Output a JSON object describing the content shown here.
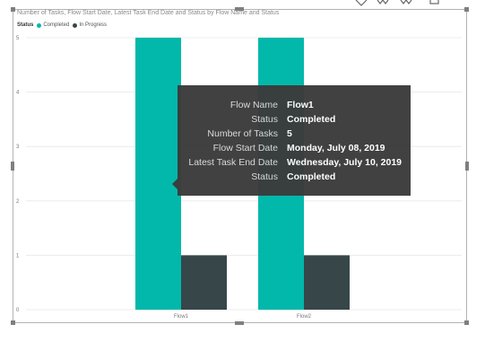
{
  "visual": {
    "title": "Number of Tasks, Flow Start Date, Latest Task End Date and Status by Flow Name and Status"
  },
  "legend": {
    "title": "Status",
    "items": [
      {
        "label": "Completed",
        "color": "#01b8aa"
      },
      {
        "label": "In Progress",
        "color": "#374649"
      }
    ]
  },
  "chart_data": {
    "type": "bar",
    "categories": [
      "Flow1",
      "Flow2"
    ],
    "series": [
      {
        "name": "Completed",
        "color": "#01b8aa",
        "values": [
          5,
          5
        ]
      },
      {
        "name": "In Progress",
        "color": "#374649",
        "values": [
          1,
          1
        ]
      }
    ],
    "ylim": [
      0,
      5
    ],
    "yticks": [
      "0",
      "1",
      "2",
      "3",
      "4",
      "5"
    ],
    "grid": true,
    "legend_position": "top-left"
  },
  "tooltip": {
    "rows": [
      {
        "key": "Flow Name",
        "value": "Flow1"
      },
      {
        "key": "Status",
        "value": "Completed"
      },
      {
        "key": "Number of Tasks",
        "value": "5"
      },
      {
        "key": "Flow Start Date",
        "value": "Monday, July 08, 2019"
      },
      {
        "key": "Latest Task End Date",
        "value": "Wednesday, July 10, 2019"
      },
      {
        "key": "Status",
        "value": "Completed"
      }
    ]
  },
  "toolbar": {
    "icons": [
      "drill-up-icon",
      "drill-down-all-icon",
      "expand-all-icon",
      "focus-mode-icon"
    ]
  }
}
